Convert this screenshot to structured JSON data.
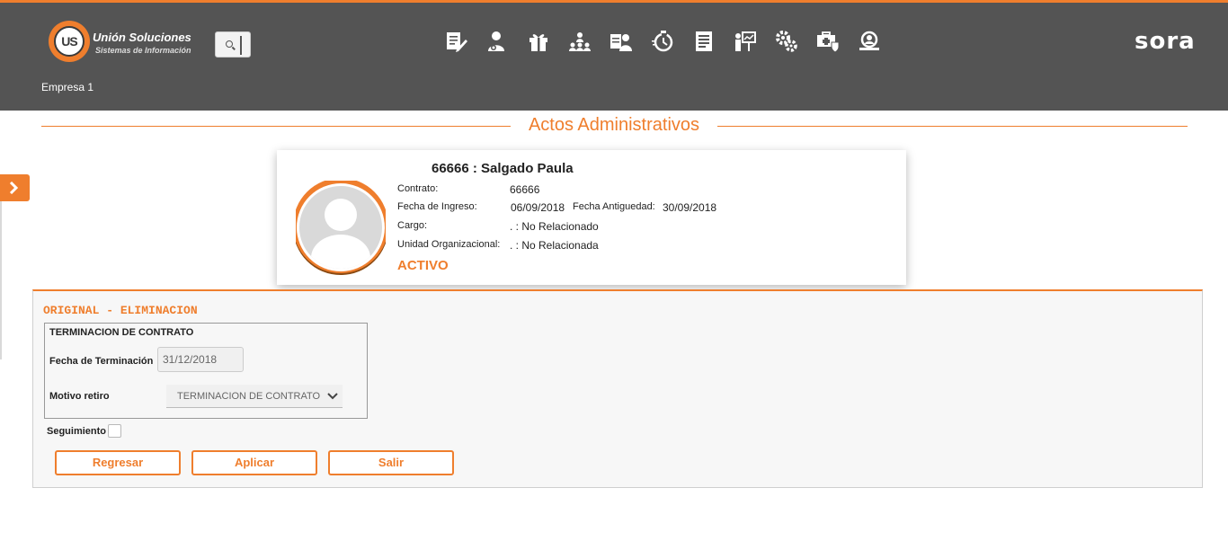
{
  "header": {
    "logo_name": "Unión Soluciones",
    "logo_subtitle": "Sistemas de Información",
    "logo_mark": "US",
    "brand": "sora",
    "company": "Empresa 1",
    "accent_color": "#ef7e2d",
    "bar_color": "#545454",
    "nav_icons": [
      "document-edit-icon",
      "person-settings-icon",
      "gift-icon",
      "team-icon",
      "person-card-icon",
      "timer-icon",
      "document-list-icon",
      "presentation-icon",
      "gears-icon",
      "medical-case-icon",
      "search-people-icon"
    ]
  },
  "page": {
    "title": "Actos Administrativos"
  },
  "employee": {
    "name": "66666 : Salgado Paula",
    "contrato_label": "Contrato:",
    "contrato_value": "66666",
    "fecha_ingreso_label": "Fecha de Ingreso:",
    "fecha_ingreso_value": "06/09/2018",
    "fecha_antiguedad_label": "Fecha Antiguedad:",
    "fecha_antiguedad_value": "30/09/2018",
    "cargo_label": "Cargo:",
    "cargo_value": ". : No Relacionado",
    "unidad_label": "Unidad Organizacional:",
    "unidad_value": ". : No Relacionada",
    "status": "ACTIVO"
  },
  "form": {
    "title": "ORIGINAL - ELIMINACION",
    "section_title": "TERMINACION DE CONTRATO",
    "fecha_terminacion_label": "Fecha de Terminación",
    "fecha_terminacion_value": "31/12/2018",
    "motivo_label": "Motivo retiro",
    "motivo_value": "TERMINACION DE CONTRATO",
    "seguimiento_label": "Seguimiento",
    "seguimiento_checked": false,
    "buttons": {
      "regresar": "Regresar",
      "aplicar": "Aplicar",
      "salir": "Salir"
    }
  }
}
